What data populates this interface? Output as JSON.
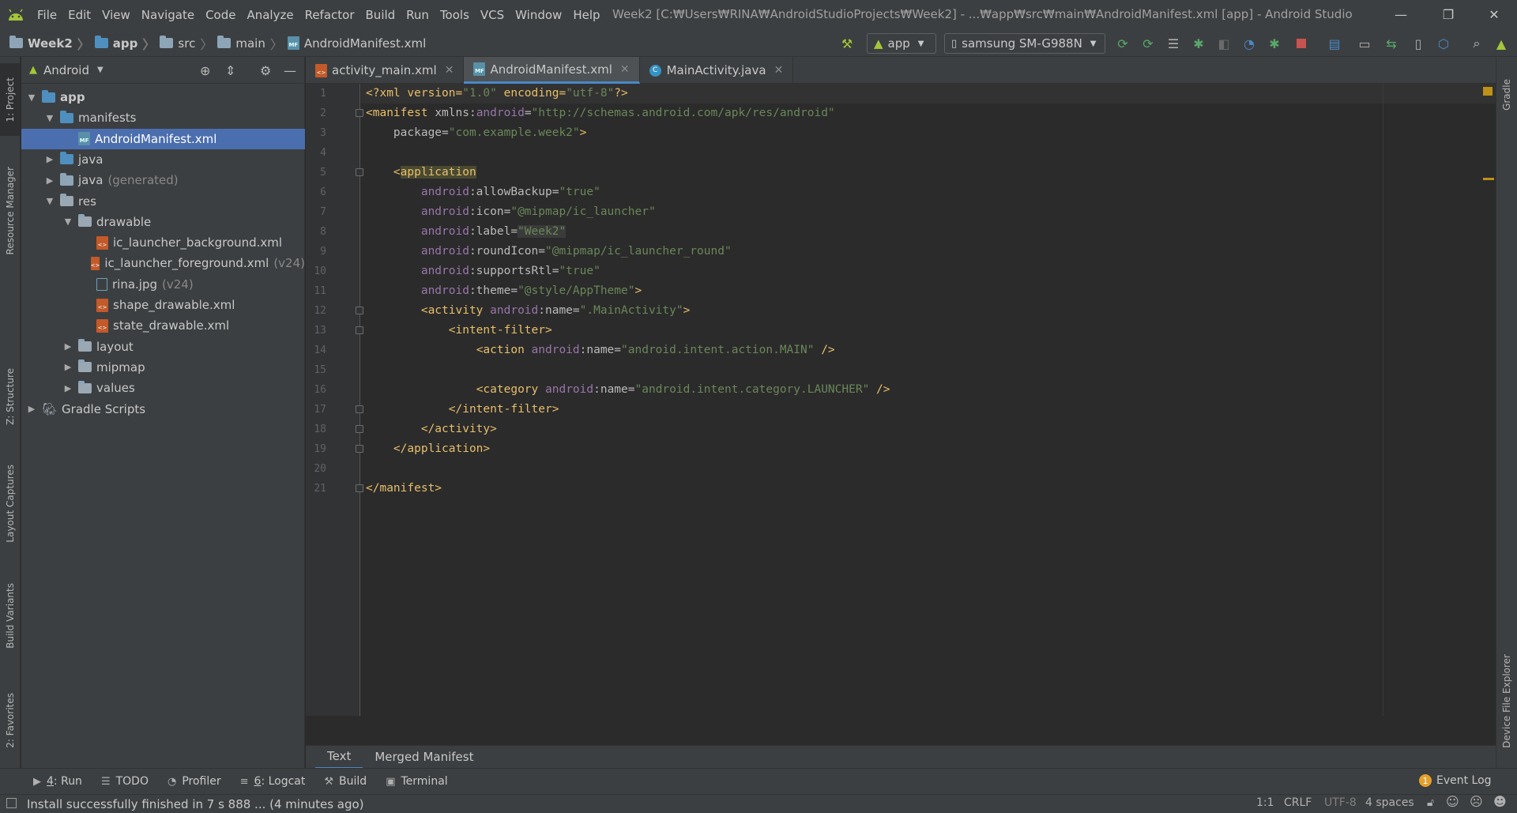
{
  "window": {
    "title": "Week2 [C:₩Users₩RINA₩AndroidStudioProjects₩Week2] - ...₩app₩src₩main₩AndroidManifest.xml [app] - Android Studio",
    "minimize": "—",
    "restore": "❐",
    "close": "✕"
  },
  "menu": [
    "File",
    "Edit",
    "View",
    "Navigate",
    "Code",
    "Analyze",
    "Refactor",
    "Build",
    "Run",
    "Tools",
    "VCS",
    "Window",
    "Help"
  ],
  "breadcrumb": [
    "Week2",
    "app",
    "src",
    "main",
    "AndroidManifest.xml"
  ],
  "toolbar": {
    "run_config": "app",
    "device": "samsung SM-G988N"
  },
  "left_tool_tabs": [
    "1: Project",
    "Resource Manager",
    "Z: Structure",
    "Layout Captures",
    "Build Variants",
    "2: Favorites"
  ],
  "right_tool_tabs": [
    "Gradle",
    "Device File Explorer"
  ],
  "project_panel": {
    "view": "Android",
    "tree": [
      {
        "label": "app",
        "depth": 0,
        "expanded": true,
        "type": "module"
      },
      {
        "label": "manifests",
        "depth": 1,
        "expanded": true,
        "type": "folder"
      },
      {
        "label": "AndroidManifest.xml",
        "depth": 2,
        "type": "manifest",
        "selected": true
      },
      {
        "label": "java",
        "depth": 1,
        "expanded": false,
        "type": "folder"
      },
      {
        "label": "java",
        "suffix": "(generated)",
        "depth": 1,
        "expanded": false,
        "type": "folder-gen"
      },
      {
        "label": "res",
        "depth": 1,
        "expanded": true,
        "type": "folder-res"
      },
      {
        "label": "drawable",
        "depth": 2,
        "expanded": true,
        "type": "folder-res"
      },
      {
        "label": "ic_launcher_background.xml",
        "depth": 3,
        "type": "xml"
      },
      {
        "label": "ic_launcher_foreground.xml",
        "suffix": "(v24)",
        "depth": 3,
        "type": "xml"
      },
      {
        "label": "rina.jpg",
        "suffix": "(v24)",
        "depth": 3,
        "type": "image"
      },
      {
        "label": "shape_drawable.xml",
        "depth": 3,
        "type": "xml"
      },
      {
        "label": "state_drawable.xml",
        "depth": 3,
        "type": "xml"
      },
      {
        "label": "layout",
        "depth": 2,
        "expanded": false,
        "type": "folder-res"
      },
      {
        "label": "mipmap",
        "depth": 2,
        "expanded": false,
        "type": "folder-res"
      },
      {
        "label": "values",
        "depth": 2,
        "expanded": false,
        "type": "folder-res"
      },
      {
        "label": "Gradle Scripts",
        "depth": 0,
        "expanded": false,
        "type": "gradle"
      }
    ]
  },
  "editor_tabs": [
    {
      "label": "activity_main.xml",
      "icon": "xml",
      "active": false
    },
    {
      "label": "AndroidManifest.xml",
      "icon": "manifest",
      "active": true
    },
    {
      "label": "MainActivity.java",
      "icon": "java",
      "active": false
    }
  ],
  "code_lines": [
    "1",
    "2",
    "3",
    "4",
    "5",
    "6",
    "7",
    "8",
    "9",
    "10",
    "11",
    "12",
    "13",
    "14",
    "15",
    "16",
    "17",
    "18",
    "19",
    "20",
    "21"
  ],
  "code": {
    "l1_a": "<?xml version=",
    "l1_b": "\"1.0\"",
    "l1_c": " encoding=",
    "l1_d": "\"utf-8\"",
    "l1_e": "?>",
    "l2_a": "<manifest ",
    "l2_b": "xmlns:",
    "l2_c": "android",
    "l2_d": "=",
    "l2_e": "\"http://schemas.android.com/apk/res/android\"",
    "l3_a": "    package=",
    "l3_b": "\"com.example.week2\"",
    "l3_c": ">",
    "l5_a": "    <",
    "l5_b": "application",
    "ns": "android",
    "l6_attr": ":allowBackup=",
    "l6_val": "\"true\"",
    "l7_attr": ":icon=",
    "l7_val": "\"@mipmap/ic_launcher\"",
    "l8_attr": ":label=",
    "l8_val": "\"Week2\"",
    "l9_attr": ":roundIcon=",
    "l9_val": "\"@mipmap/ic_launcher_round\"",
    "l10_attr": ":supportsRtl=",
    "l10_val": "\"true\"",
    "l11_attr": ":theme=",
    "l11_val": "\"@style/AppTheme\"",
    "l11_end": ">",
    "l12_tag": "<activity ",
    "l12_attr": ":name=",
    "l12_val": "\".MainActivity\"",
    "l12_end": ">",
    "l13": "<intent-filter>",
    "l14_tag": "<action ",
    "l14_attr": ":name=",
    "l14_val": "\"android.intent.action.MAIN\"",
    "l14_end": " />",
    "l16_tag": "<category ",
    "l16_attr": ":name=",
    "l16_val": "\"android.intent.category.LAUNCHER\"",
    "l16_end": " />",
    "l17": "</intent-filter>",
    "l18": "</activity>",
    "l19": "</application>",
    "l21": "</manifest>"
  },
  "bottom_editor_tabs": [
    "Text",
    "Merged Manifest"
  ],
  "tool_windows": [
    {
      "key": "4",
      "label": ": Run",
      "icon": "▶"
    },
    {
      "key": "",
      "label": "TODO",
      "icon": "☰"
    },
    {
      "key": "",
      "label": "Profiler",
      "icon": "◔"
    },
    {
      "key": "6",
      "label": ": Logcat",
      "icon": "≡"
    },
    {
      "key": "",
      "label": "Build",
      "icon": "⚒"
    },
    {
      "key": "",
      "label": "Terminal",
      "icon": "▣"
    }
  ],
  "event_log": {
    "count": "1",
    "label": "Event Log"
  },
  "status": {
    "message": "Install successfully finished in 7 s 888 ... (4 minutes ago)",
    "position": "1:1",
    "line_sep": "CRLF",
    "encoding": "UTF-8",
    "indent": "4 spaces"
  },
  "colors": {
    "background": "#2b2b2b",
    "panel": "#3c3f41",
    "selection": "#4b6eaf",
    "accent": "#4a88c7",
    "android_green": "#a4c639"
  }
}
